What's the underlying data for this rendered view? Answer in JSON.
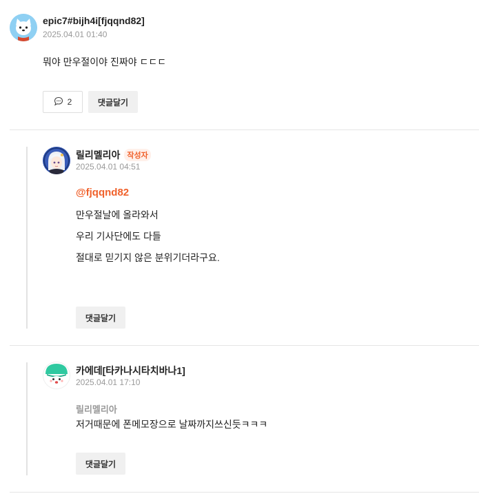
{
  "comments": [
    {
      "author": "epic7#bijh4i[fjqqnd82]",
      "date": "2025.04.01 01:40",
      "text": "뭐야 만우절이야 진짜야 ㄷㄷㄷ",
      "reply_count": "2",
      "reply_button": "댓글달기",
      "avatar_icon": "white-dog-mascot-icon"
    }
  ],
  "replies": [
    {
      "author": "릴리멜리아",
      "badge": "작성자",
      "date": "2025.04.01 04:51",
      "mention": "@fjqqnd82",
      "lines": [
        "만우절날에 올라와서",
        "우리 기사단에도 다들",
        "절대로 믿기지 않은 분위기더라구요."
      ],
      "reply_button": "댓글달기",
      "avatar_icon": "white-haired-character-icon"
    },
    {
      "author": "카에데[타카나시타치바나1]",
      "date": "2025.04.01 17:10",
      "quote_name": "릴리멜리아",
      "text": "저거때문에 폰메모장으로 날짜까지쓰신듯ㅋㅋㅋ",
      "reply_button": "댓글달기",
      "avatar_icon": "green-slime-mascot-icon"
    }
  ],
  "colors": {
    "accent": "#f0612b",
    "muted": "#999999",
    "button_bg": "#f0f0f0",
    "divider": "#e5e5e5"
  }
}
